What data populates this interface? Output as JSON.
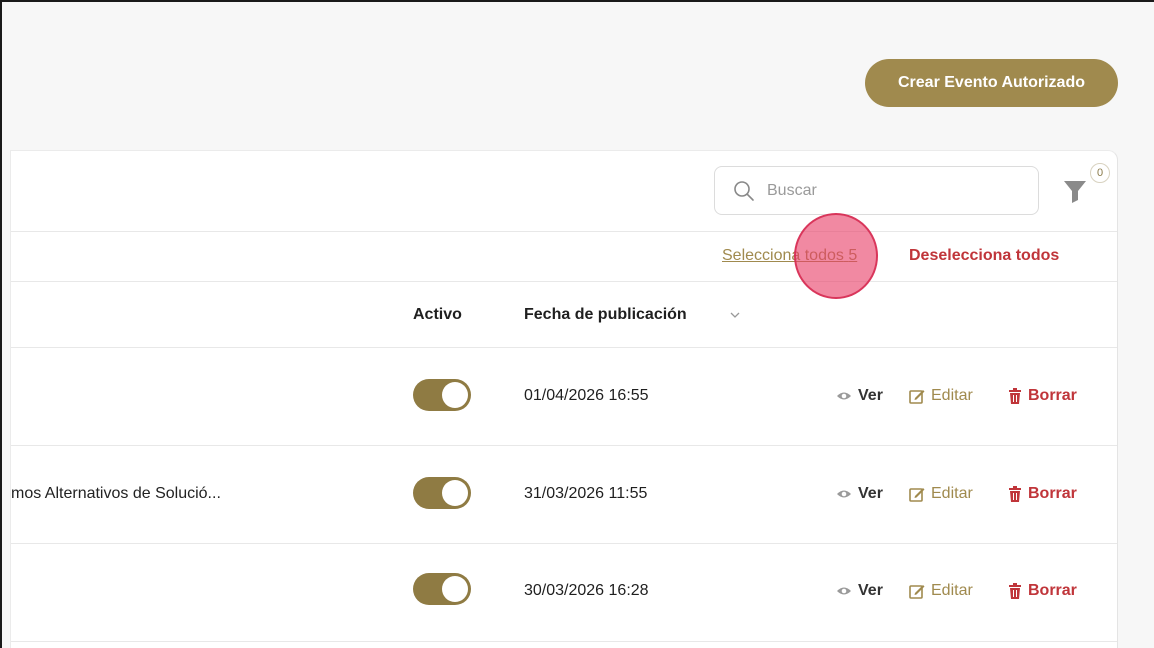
{
  "header": {
    "create_button_label": "Crear Evento Autorizado"
  },
  "toolbar": {
    "search_placeholder": "Buscar",
    "filter_count": "0"
  },
  "selection": {
    "select_all_label": "Selecciona todos",
    "select_all_count": "5",
    "deselect_all_label": "Deselecciona todos"
  },
  "table": {
    "columns": {
      "active": "Activo",
      "published": "Fecha de publicación"
    },
    "rows": [
      {
        "title": "",
        "active": true,
        "date": "01/04/2026 16:55"
      },
      {
        "title": "mos Alternativos de Solució...",
        "active": true,
        "date": "31/03/2026 11:55"
      },
      {
        "title": "",
        "active": true,
        "date": "30/03/2026 16:28"
      }
    ],
    "actions": {
      "view": "Ver",
      "edit": "Editar",
      "delete": "Borrar"
    }
  },
  "colors": {
    "accent": "#a08a4e",
    "toggle_on": "#8f7b43",
    "danger": "#c0353a",
    "click_indicator": "#e84169"
  },
  "icons": [
    "search-icon",
    "filter-icon",
    "chevron-down-icon",
    "eye-icon",
    "edit-icon",
    "trash-icon"
  ]
}
